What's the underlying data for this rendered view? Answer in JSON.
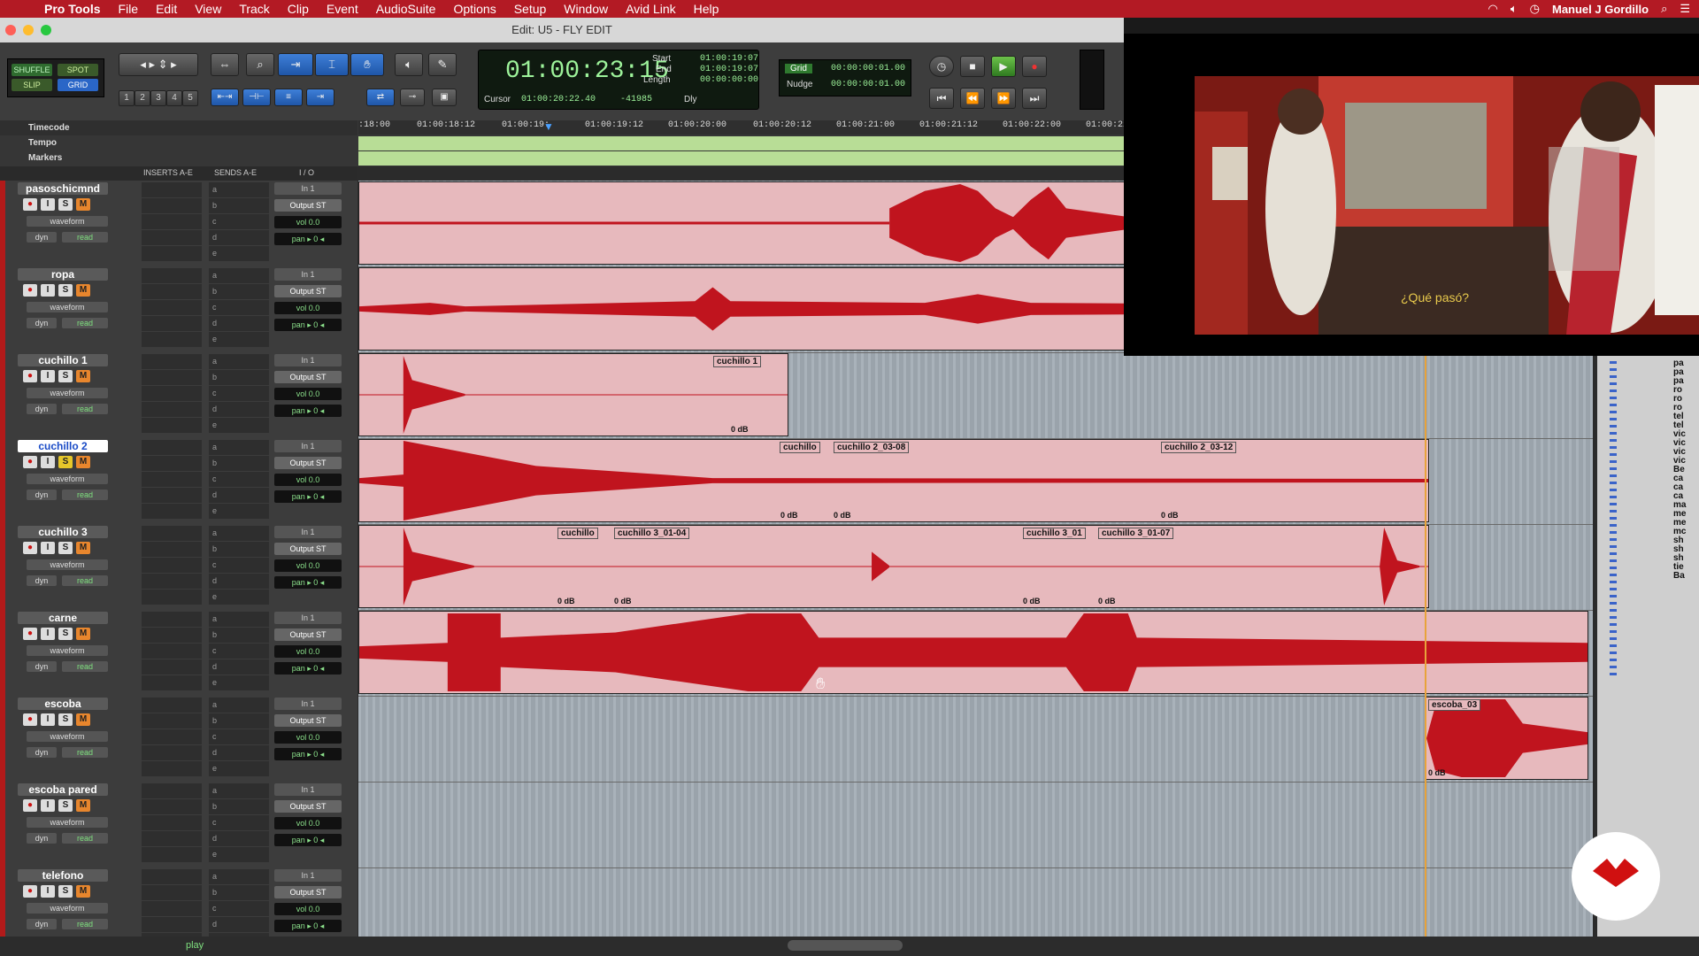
{
  "menubar": {
    "app_name": "Pro Tools",
    "items": [
      "File",
      "Edit",
      "View",
      "Track",
      "Clip",
      "Event",
      "AudioSuite",
      "Options",
      "Setup",
      "Window",
      "Avid Link",
      "Help"
    ],
    "user": "Manuel J Gordillo"
  },
  "window_title": "Edit: U5 - FLY EDIT",
  "modes": {
    "shuffle": "SHUFFLE",
    "spot": "SPOT",
    "slip": "SLIP",
    "grid": "GRID"
  },
  "zoom_presets": [
    "1",
    "2",
    "3",
    "4",
    "5"
  ],
  "counter": {
    "main": "01:00:23:15",
    "start_label": "Start",
    "start": "01:00:19:07",
    "end_label": "End",
    "end": "01:00:19:07",
    "length_label": "Length",
    "length": "00:00:00:00",
    "cursor_label": "Cursor",
    "cursor": "01:00:20:22.40",
    "sample": "-41985",
    "dly": "Dly"
  },
  "grid": {
    "grid_label": "Grid",
    "grid_value": "00:00:00:01.00",
    "nudge_label": "Nudge",
    "nudge_value": "00:00:00:01.00"
  },
  "rulers": {
    "timecode_label": "Timecode",
    "tempo_label": "Tempo",
    "markers_label": "Markers",
    "ticks": [
      ":18:00",
      "01:00:18:12",
      "01:00:19:",
      "01:00:19:12",
      "01:00:20:00",
      "01:00:20:12",
      "01:00:21:00",
      "01:00:21:12",
      "01:00:22:00",
      "01:00:22"
    ]
  },
  "column_headers": {
    "inserts": "INSERTS A-E",
    "sends": "SENDS A-E",
    "io": "I / O"
  },
  "tracks": [
    {
      "name": "pasoschicmnd",
      "selected": false
    },
    {
      "name": "ropa",
      "selected": false
    },
    {
      "name": "cuchillo 1",
      "selected": false
    },
    {
      "name": "cuchillo 2",
      "selected": true
    },
    {
      "name": "cuchillo 3",
      "selected": false
    },
    {
      "name": "carne",
      "selected": false
    },
    {
      "name": "escoba",
      "selected": false
    },
    {
      "name": "escoba pared",
      "selected": false
    },
    {
      "name": "telefono",
      "selected": false
    }
  ],
  "track_controls": {
    "rec": "●",
    "input": "I",
    "solo": "S",
    "mute": "M",
    "view": "waveform",
    "dyn": "dyn",
    "auto": "read",
    "insert_slots": [
      "a",
      "b",
      "c",
      "d",
      "e"
    ],
    "input_label": "In 1",
    "output_label": "Output ST",
    "vol_label": "vol",
    "vol_value": "0.0",
    "pan_label": "pan",
    "pan_value": "▸ 0 ◂"
  },
  "clips": {
    "cuchillo1": "cuchillo 1",
    "cuchillo": "cuchillo",
    "cuchillo2_0308": "cuchillo 2_03-08",
    "cuchillo2_0312": "cuchillo 2_03-12",
    "cuchillo3_0104": "cuchillo 3_01-04",
    "cuchillo3_01": "cuchillo 3_01",
    "cuchillo3_0107": "cuchillo 3_01-07",
    "escoba03": "escoba_03",
    "gain": "0 dB"
  },
  "video": {
    "subtitle": "¿Qué pasó?"
  },
  "right_clip_list": [
    "pa",
    "pa",
    "pa",
    "ro",
    "ro",
    "ro",
    "tel",
    "tel",
    "vic",
    "vic",
    "vic",
    "vic",
    "Be",
    "ca",
    "ca",
    "ca",
    "ma",
    "me",
    "me",
    "mc",
    "sh",
    "sh",
    "sh",
    "tie",
    "Ba"
  ],
  "status": {
    "play": "play"
  },
  "colors": {
    "menubar": "#b31a24",
    "waveform": "#c0141e",
    "clip_bg": "#e7b9bd",
    "counter_text": "#9df29a"
  }
}
